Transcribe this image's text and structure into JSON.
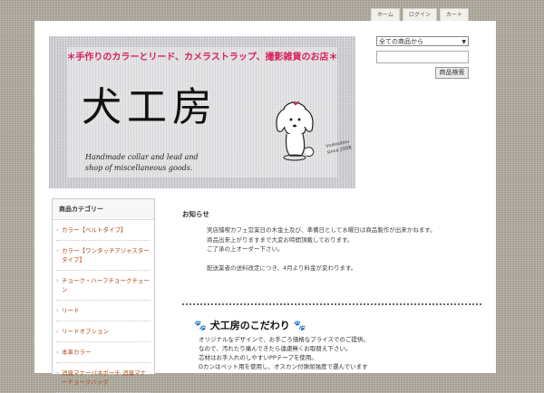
{
  "top_nav": [
    "ホーム",
    "ログイン",
    "カート"
  ],
  "banner": {
    "tagline": "＊手作りのカラーとリード、カメラストラップ、撮影雑貨のお店＊",
    "logo_text": "犬工房",
    "english_line1": "Handmade collar and lead and",
    "english_line2": "shop of miscellaneous goods.",
    "since": "inukoubou\nsince 2008"
  },
  "search": {
    "select_value": "全ての商品から",
    "input_value": "",
    "button_label": "商品検索"
  },
  "sidebar": {
    "title": "商品カテゴリー",
    "items": [
      "カラー【ベルトタイプ】",
      "カラー【ワンタッチアジャスタータイプ】",
      "チョーク・ハーフチョークチェーン",
      "リード",
      "リードオプション",
      "本革カラー",
      "消臭マナーパネポーチ 消臭マナーチョークバッグ"
    ]
  },
  "news": {
    "title": "お知らせ",
    "lines": [
      "実店舗喫カフェ営業日の木金土及び、凖備日として水曜日は商品製作が出来かねます。",
      "商品出来上がりますまで大変お時間頂戴しております。",
      "ご了承の上オーダー下さい。",
      "",
      "配送業者の送料改定につき、4月より料金が変わります。"
    ]
  },
  "kodawari": {
    "title": "犬工房のこだわり",
    "lines": [
      "オリジナルなデザインで、お手ごろ価格なプライスでのご提供。",
      "なので、汚れたり痛んできたら遠慮無くお取替え下さい。",
      "芯材はお手入れのしやすいPPテープを使用。",
      "Dカンはペット用を使用し、オスカン付弾屈強度で選んでいます"
    ]
  },
  "colors": {
    "background": "#b2ad9f",
    "tagline": "#d9205f",
    "link": "#b04a1a"
  }
}
